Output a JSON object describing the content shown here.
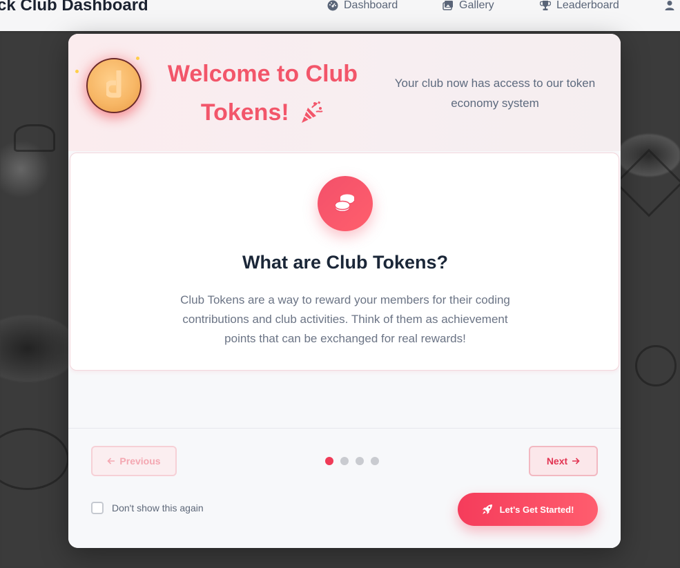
{
  "nav": {
    "brand": "ck Club Dashboard",
    "items": [
      {
        "label": "Dashboard",
        "icon": "dashboard-gauge-icon"
      },
      {
        "label": "Gallery",
        "icon": "gallery-images-icon"
      },
      {
        "label": "Leaderboard",
        "icon": "trophy-icon"
      }
    ],
    "user_icon": "user-icon"
  },
  "modal": {
    "header": {
      "title_line1": "Welcome to Club",
      "title_line2": "Tokens!",
      "subtitle": "Your club now has access to our token economy system",
      "coin_icon": "coin-icon",
      "party_icon": "party-popper-icon"
    },
    "step": {
      "icon": "coins-stack-icon",
      "title": "What are Club Tokens?",
      "text": "Club Tokens are a way to reward your members for their coding contributions and club activities. Think of them as achievement points that can be exchanged for real rewards!"
    },
    "footer": {
      "previous_label": "Previous",
      "next_label": "Next",
      "pagination": {
        "total": 4,
        "current": 1
      },
      "dont_show_label": "Don't show this again",
      "dont_show_checked": false,
      "start_label": "Let's Get Started!"
    }
  },
  "colors": {
    "accent": "#f2566a",
    "accent_dark": "#ef3b57",
    "text_dark": "#1b2738",
    "text_muted": "#6b7485"
  }
}
